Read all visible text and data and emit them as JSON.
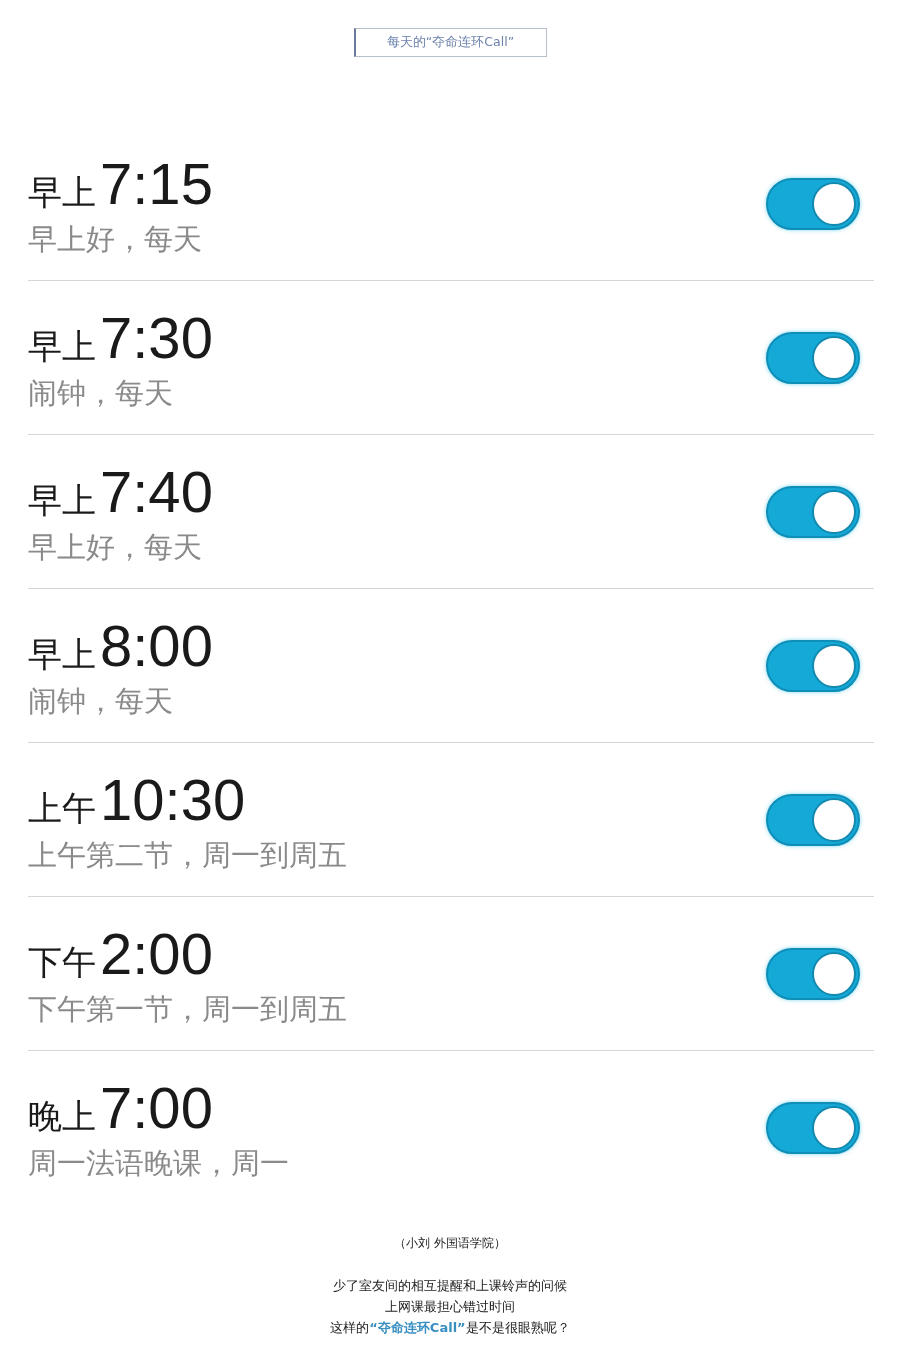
{
  "header": {
    "title": "每天的“夺命连环Call”"
  },
  "alarms": [
    {
      "period": "早上",
      "time": "7:15",
      "label": "早上好，每天",
      "on": true
    },
    {
      "period": "早上",
      "time": "7:30",
      "label": "闹钟，每天",
      "on": true
    },
    {
      "period": "早上",
      "time": "7:40",
      "label": "早上好，每天",
      "on": true
    },
    {
      "period": "早上",
      "time": "8:00",
      "label": "闹钟，每天",
      "on": true
    },
    {
      "period": "上午",
      "time": "10:30",
      "label": "上午第二节，周一到周五",
      "on": true
    },
    {
      "period": "下午",
      "time": "2:00",
      "label": "下午第一节，周一到周五",
      "on": true
    },
    {
      "period": "晚上",
      "time": "7:00",
      "label": "周一法语晚课，周一",
      "on": true
    }
  ],
  "caption": "（小刘 外国语学院）",
  "paragraph": [
    {
      "parts": [
        {
          "text": "少了室友间的相互提醒和上课铃声的问候",
          "highlight": false
        }
      ]
    },
    {
      "parts": [
        {
          "text": "上网课最担心错过时间",
          "highlight": false
        }
      ]
    },
    {
      "parts": [
        {
          "text": "这样的",
          "highlight": false
        },
        {
          "text": "“夺命连环Call”",
          "highlight": true
        },
        {
          "text": "是不是很眼熟呢？",
          "highlight": false
        }
      ]
    }
  ]
}
